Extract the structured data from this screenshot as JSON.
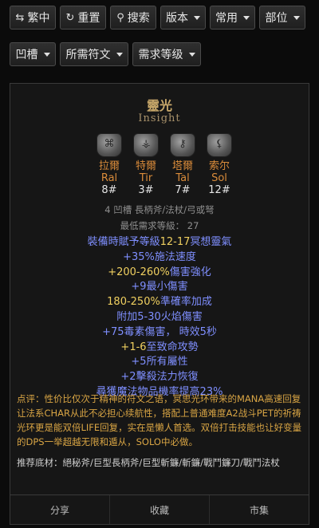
{
  "toolbar": {
    "row1": [
      {
        "icon": "⇆",
        "label": "繁中",
        "caret": false
      },
      {
        "icon": "↻",
        "label": "重置",
        "caret": false
      },
      {
        "icon": "⚲",
        "label": "搜索",
        "caret": false
      },
      {
        "label": "版本",
        "caret": true
      },
      {
        "label": "常用",
        "caret": true
      },
      {
        "label": "部位",
        "caret": true
      }
    ],
    "row2": [
      {
        "label": "凹槽",
        "caret": true
      },
      {
        "label": "所需符文",
        "caret": true
      },
      {
        "label": "需求等级",
        "caret": true
      }
    ]
  },
  "runeword": {
    "name_cn": "靈光",
    "name_en": "Insight",
    "runes": [
      {
        "cn": "拉爾",
        "en": "Ral",
        "num": "8#"
      },
      {
        "cn": "特爾",
        "en": "Tir",
        "num": "3#"
      },
      {
        "cn": "塔爾",
        "en": "Tal",
        "num": "7#"
      },
      {
        "cn": "索尔",
        "en": "Sol",
        "num": "12#"
      }
    ],
    "sockets_line": "4 凹槽 長柄斧/法杖/弓或弩",
    "level_line": "最低需求等級： 27",
    "stats": [
      {
        "pre": "裝備時賦予等級",
        "hl": "12-17",
        "post": "冥想靈氣"
      },
      {
        "pre": "+35%施法速度",
        "hl": "",
        "post": ""
      },
      {
        "pre": "",
        "hl": "+200-260%",
        "post": "傷害強化"
      },
      {
        "pre": "+9最小傷害",
        "hl": "",
        "post": ""
      },
      {
        "pre": "",
        "hl": "180-250%",
        "post": "準確率加成"
      },
      {
        "pre": "附加5-30火焰傷害",
        "hl": "",
        "post": ""
      },
      {
        "pre": "+75毒素傷害， 時效5秒",
        "hl": "",
        "post": ""
      },
      {
        "pre": "",
        "hl": "+1-6",
        "post": "至致命攻勢"
      },
      {
        "pre": "+5所有屬性",
        "hl": "",
        "post": ""
      },
      {
        "pre": "+2擊殺法力恢復",
        "hl": "",
        "post": ""
      },
      {
        "pre": "尋獲魔法物品機率提高23%",
        "hl": "",
        "post": ""
      }
    ],
    "comment": "点评：性价比仅次于精神的符文之语，冥思光环带来的MANA高速回复让法系CHAR从此不必担心续航性，搭配上普通难度A2战斗PET的祈祷光环更是能双倍LIFE回复，实在是懒人首选。双倍打击技能也让好变量的DPS一举超越无限和遁从，SOLO中必做。",
    "recommend": "推荐底材：絕秘斧/巨型長柄斧/巨型斬鐮/斬鐮/戰鬥鐮刀/戰鬥法杖"
  },
  "footer": {
    "share": "分享",
    "favorite": "收藏",
    "market": "市集"
  },
  "icons": {
    "swap": "swap-icon",
    "refresh": "refresh-icon",
    "search": "search-icon",
    "caret": "caret-down-icon"
  },
  "colors": {
    "title": "#c8a86a",
    "rune_name": "#d98b3a",
    "stat_blue": "#7f8fff",
    "stat_highlight": "#f0d060",
    "comment": "#d9a544"
  }
}
